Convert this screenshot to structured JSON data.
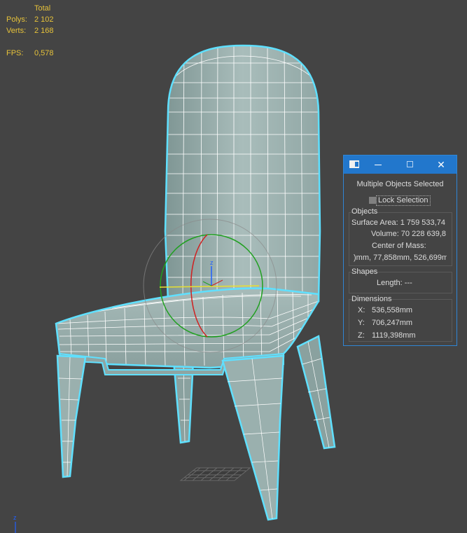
{
  "viewport_stats": {
    "header": "Total",
    "polys_label": "Polys:",
    "polys_value": "2 102",
    "verts_label": "Verts:",
    "verts_value": "2 168",
    "fps_label": "FPS:",
    "fps_value": "0,578"
  },
  "gizmo": {
    "axis_label": "z"
  },
  "corner_axis": {
    "label": "z"
  },
  "panel": {
    "title": "Multiple Objects Selected",
    "lock_selection_label": "Lock Selection",
    "lock_selection_checked": false,
    "objects": {
      "label": "Objects",
      "surface_area": "Surface Area: 1 759 533,74",
      "volume": "Volume: 70 228 639,8",
      "center_of_mass_label": "Center of Mass:",
      "center_of_mass_value": ")mm, 77,858mm, 526,699m"
    },
    "shapes": {
      "label": "Shapes",
      "length": "Length: ---"
    },
    "dimensions": {
      "label": "Dimensions",
      "x_label": "X:",
      "x_value": "536,558mm",
      "y_label": "Y:",
      "y_value": "706,247mm",
      "z_label": "Z:",
      "z_value": "1119,398mm"
    }
  },
  "colors": {
    "viewport_bg": "#444444",
    "wireframe": "#ffffff",
    "selection_outline": "#5fe0ff",
    "stats_text": "#e6c23a",
    "titlebar": "#2277cc",
    "gizmo_x": "#d02020",
    "gizmo_y": "#20a020",
    "gizmo_z": "#2060ff"
  }
}
